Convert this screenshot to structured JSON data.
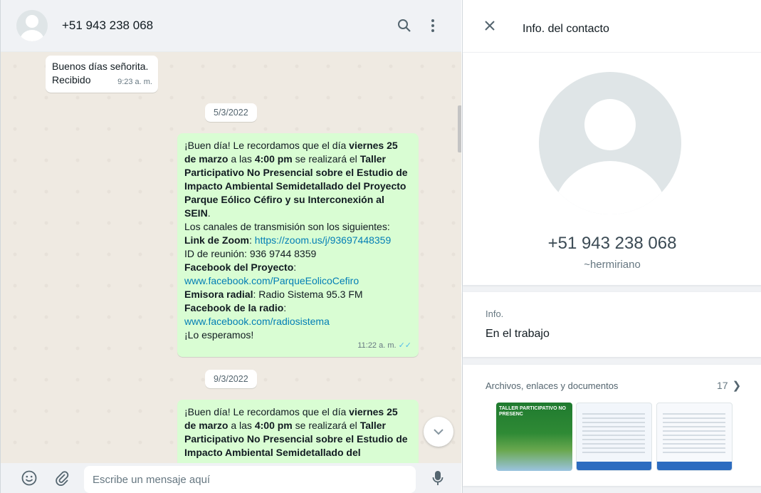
{
  "chat_header": {
    "contact_name": "+51 943 238 068",
    "icons": [
      "search-icon",
      "menu-dots-icon"
    ]
  },
  "messages": {
    "m1": {
      "line1": "Buenos días señorita.",
      "line2": "Recibido",
      "time": "9:23 a. m."
    },
    "date1": "5/3/2022",
    "m2": {
      "p1a": "¡Buen día! Le recordamos que el día ",
      "p1b": "viernes 25 de marzo",
      "p1c": " a las ",
      "p1d": "4:00 pm",
      "p1e": " se realizará el ",
      "p1f": "Taller Participativo No Presencial sobre el Estudio de Impacto Ambiental Semidetallado del Proyecto Parque Eólico Céfiro y su Interconexión al SEIN",
      "p1g": ".",
      "channels": "Los canales de transmisión son los siguientes:",
      "zoom_label": "Link de Zoom",
      "zoom_url": "https://zoom.us/j/93697448359",
      "meeting_id": "ID de reunión: 936 9744 8359",
      "fb_project_label": "Facebook del Proyecto",
      "fb_project_url": "www.facebook.com/ParqueEolicoCefiro",
      "radio_label": "Emisora radial",
      "radio_value": ": Radio Sistema 95.3 FM",
      "fb_radio_label": "Facebook de la radio",
      "fb_radio_url": "www.facebook.com/radiosistema",
      "closing": "¡Lo esperamos!",
      "time": "11:22 a. m."
    },
    "date2": "9/3/2022",
    "m3": {
      "p1a": "¡Buen día! Le recordamos que el día ",
      "p1b": "viernes 25 de marzo",
      "p1c": " a las ",
      "p1d": "4:00 pm",
      "p1e": " se realizará el ",
      "p1f": "Taller Participativo No Presencial sobre el Estudio de Impacto Ambiental Semidetallado del"
    }
  },
  "composer": {
    "placeholder": "Escribe un mensaje aquí",
    "icons": [
      "emoji-icon",
      "attach-icon",
      "microphone-icon"
    ]
  },
  "info_panel": {
    "title": "Info. del contacto",
    "phone": "+51 943 238 068",
    "alias": "~hermiriano",
    "about_label": "Info.",
    "about_value": "En el trabajo",
    "media_label": "Archivos, enlaces y documentos",
    "media_count": "17",
    "thumb1_text": "TALLER PARTICIPATIVO NO PRESENC"
  },
  "colors": {
    "outgoing_bubble": "#d9fdd3",
    "incoming_bubble": "#ffffff",
    "chat_background": "#efeae2",
    "link": "#027eb5",
    "read_ticks": "#53bdeb"
  }
}
